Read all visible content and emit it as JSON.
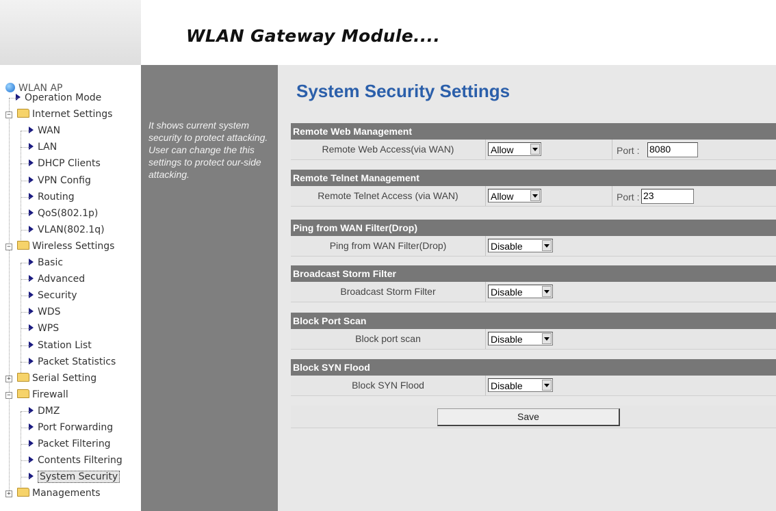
{
  "header": {
    "title": "WLAN Gateway Module...."
  },
  "sidebar": {
    "root": "WLAN AP",
    "items": [
      {
        "label": "Operation Mode",
        "type": "leaf"
      },
      {
        "label": "Internet Settings",
        "type": "folder",
        "expanded": true
      },
      {
        "label": "WAN",
        "type": "leaf"
      },
      {
        "label": "LAN",
        "type": "leaf"
      },
      {
        "label": "DHCP Clients",
        "type": "leaf"
      },
      {
        "label": "VPN Config",
        "type": "leaf"
      },
      {
        "label": "Routing",
        "type": "leaf"
      },
      {
        "label": "QoS(802.1p)",
        "type": "leaf"
      },
      {
        "label": "VLAN(802.1q)",
        "type": "leaf"
      },
      {
        "label": "Wireless Settings",
        "type": "folder",
        "expanded": true
      },
      {
        "label": "Basic",
        "type": "leaf"
      },
      {
        "label": "Advanced",
        "type": "leaf"
      },
      {
        "label": "Security",
        "type": "leaf"
      },
      {
        "label": "WDS",
        "type": "leaf"
      },
      {
        "label": "WPS",
        "type": "leaf"
      },
      {
        "label": "Station List",
        "type": "leaf"
      },
      {
        "label": "Packet Statistics",
        "type": "leaf"
      },
      {
        "label": "Serial Setting",
        "type": "folder",
        "expanded": false
      },
      {
        "label": "Firewall",
        "type": "folder",
        "expanded": true
      },
      {
        "label": "DMZ",
        "type": "leaf"
      },
      {
        "label": "Port Forwarding",
        "type": "leaf"
      },
      {
        "label": "Packet Filtering",
        "type": "leaf"
      },
      {
        "label": "Contents Filtering",
        "type": "leaf"
      },
      {
        "label": "System Security",
        "type": "leaf",
        "selected": true
      },
      {
        "label": "Managements",
        "type": "folder",
        "expanded": false
      }
    ]
  },
  "description": {
    "text": "It shows current system security to protect attacking. User can change the this settings to protect our-side attacking."
  },
  "main": {
    "title": "System Security Settings",
    "sections": [
      {
        "header": "Remote Web Management",
        "label": "Remote Web Access(via WAN)",
        "value": "Allow",
        "port_label": "Port :",
        "port_value": "8080"
      },
      {
        "header": "Remote Telnet Management",
        "label": "Remote Telnet Access (via WAN)",
        "value": "Allow",
        "port_label": "Port :",
        "port_value": "23"
      },
      {
        "header": "Ping from WAN Filter(Drop)",
        "label": "Ping from WAN Filter(Drop)",
        "value": "Disable"
      },
      {
        "header": "Broadcast Storm Filter",
        "label": "Broadcast Storm Filter",
        "value": "Disable"
      },
      {
        "header": "Block Port Scan",
        "label": "Block port scan",
        "value": "Disable"
      },
      {
        "header": "Block SYN Flood",
        "label": "Block SYN Flood",
        "value": "Disable"
      }
    ],
    "save_label": "Save"
  },
  "colors": {
    "title_blue": "#2b5faa",
    "section_header": "#777777",
    "description_panel": "#7f7f7f"
  }
}
